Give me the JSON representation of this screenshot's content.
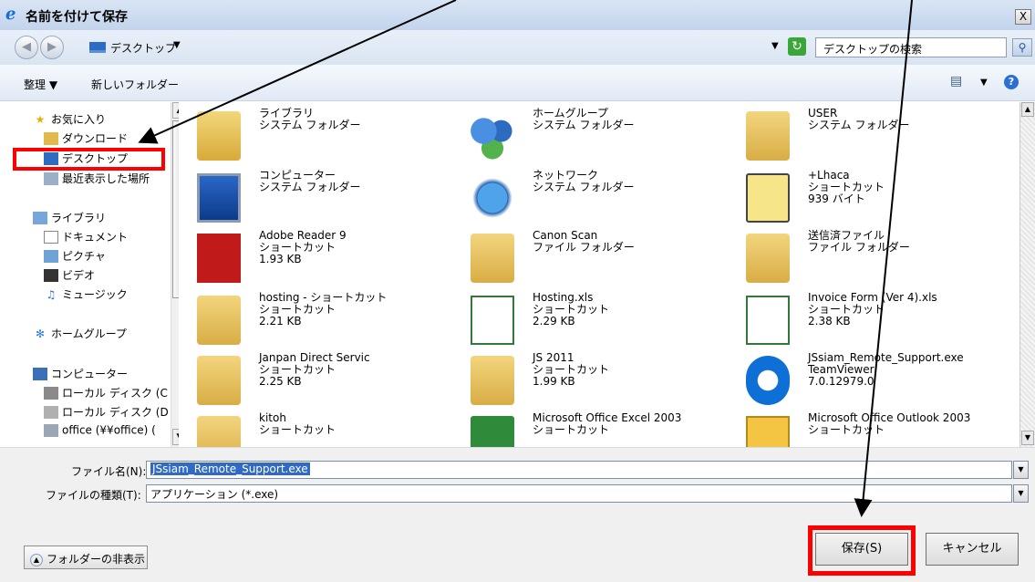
{
  "window": {
    "title": "名前を付けて保存",
    "close_label": "X"
  },
  "address": {
    "location": "デスクトップ",
    "search_placeholder": "デスクトップの検索"
  },
  "toolbar": {
    "organize": "整理 ▼",
    "new_folder": "新しいフォルダー"
  },
  "nav": {
    "favorites": "お気に入り",
    "downloads": "ダウンロード",
    "desktop": "デスクトップ",
    "recent": "最近表示した場所",
    "libraries": "ライブラリ",
    "documents": "ドキュメント",
    "pictures": "ピクチャ",
    "videos": "ビデオ",
    "music": "ミュージック",
    "homegroup": "ホームグループ",
    "computer": "コンピューター",
    "local_disk_c": "ローカル ディスク (C",
    "local_disk_d": "ローカル ディスク (D",
    "office": "office (¥¥office) ("
  },
  "files": [
    {
      "name": "ライブラリ",
      "l2": "システム フォルダー",
      "l3": "",
      "icon": "library-icon"
    },
    {
      "name": "ホームグループ",
      "l2": "システム フォルダー",
      "l3": "",
      "icon": "homegroup-icon"
    },
    {
      "name": "USER",
      "l2": "システム フォルダー",
      "l3": "",
      "icon": "user-folder-icon"
    },
    {
      "name": "コンピューター",
      "l2": "システム フォルダー",
      "l3": "",
      "icon": "computer-icon"
    },
    {
      "name": "ネットワーク",
      "l2": "システム フォルダー",
      "l3": "",
      "icon": "network-icon"
    },
    {
      "name": "+Lhaca",
      "l2": "ショートカット",
      "l3": "939 バイト",
      "icon": "lhaca-icon"
    },
    {
      "name": "Adobe Reader 9",
      "l2": "ショートカット",
      "l3": "1.93 KB",
      "icon": "adobe-reader-icon"
    },
    {
      "name": "Canon Scan",
      "l2": "ファイル フォルダー",
      "l3": "",
      "icon": "folder-icon"
    },
    {
      "name": "送信済ファイル",
      "l2": "ファイル フォルダー",
      "l3": "",
      "icon": "folder-icon"
    },
    {
      "name": "hosting - ショートカット",
      "l2": "ショートカット",
      "l3": "2.21 KB",
      "icon": "folder-shortcut-icon"
    },
    {
      "name": "Hosting.xls",
      "l2": "ショートカット",
      "l3": "2.29 KB",
      "icon": "excel-shortcut-icon"
    },
    {
      "name": "Invoice Form (Ver 4).xls",
      "l2": "ショートカット",
      "l3": "2.38 KB",
      "icon": "excel-shortcut-icon"
    },
    {
      "name": "Janpan Direct Servic",
      "l2": "ショートカット",
      "l3": "2.25 KB",
      "icon": "folder-shortcut-icon"
    },
    {
      "name": "JS 2011",
      "l2": "ショートカット",
      "l3": "1.99 KB",
      "icon": "folder-shortcut-icon"
    },
    {
      "name": "JSsiam_Remote_Support.exe",
      "l2": "TeamViewer",
      "l3": "7.0.12979.0",
      "icon": "teamviewer-icon"
    },
    {
      "name": "kitoh",
      "l2": "ショートカット",
      "l3": "",
      "icon": "folder-shortcut-icon"
    },
    {
      "name": "Microsoft Office Excel 2003",
      "l2": "ショートカット",
      "l3": "",
      "icon": "excel-icon"
    },
    {
      "name": "Microsoft Office Outlook 2003",
      "l2": "ショートカット",
      "l3": "",
      "icon": "outlook-icon"
    }
  ],
  "form": {
    "filename_label": "ファイル名(N):",
    "filename_value": "JSsiam_Remote_Support.exe",
    "filetype_label": "ファイルの種類(T):",
    "filetype_value": "アプリケーション (*.exe)"
  },
  "buttons": {
    "hide_folders": "フォルダーの非表示",
    "save": "保存(S)",
    "cancel": "キャンセル"
  }
}
